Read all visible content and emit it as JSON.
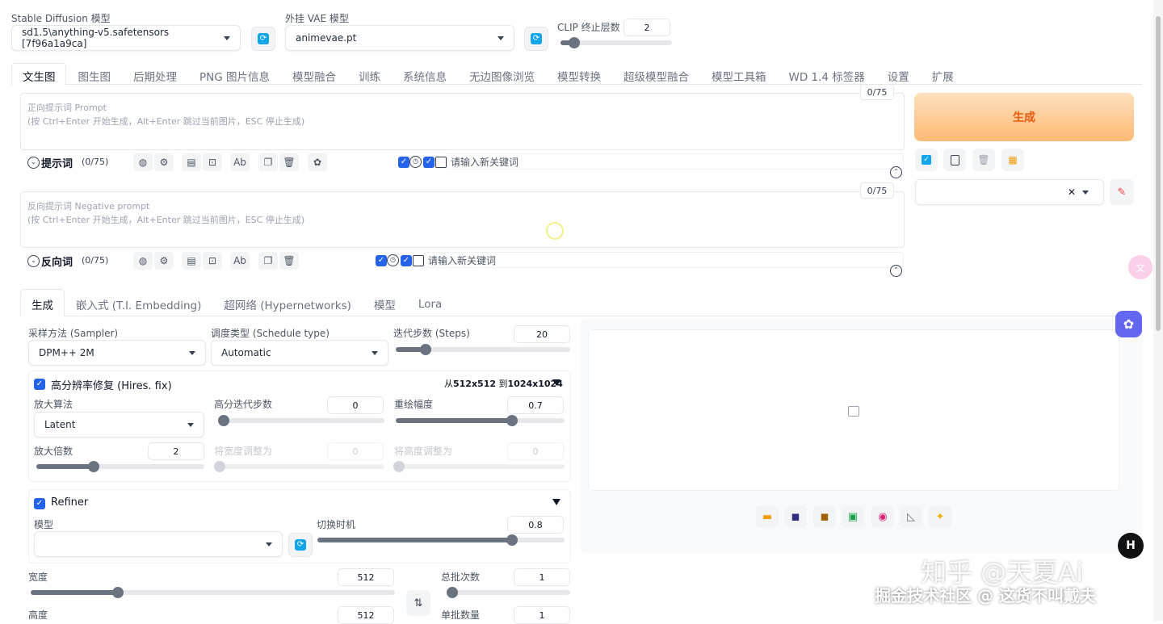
{
  "top": {
    "sd_model": {
      "label": "Stable Diffusion 模型",
      "value": "sd1.5\\anything-v5.safetensors [7f96a1a9ca]"
    },
    "vae": {
      "label": "外挂 VAE 模型",
      "value": "animevae.pt"
    },
    "clip": {
      "label": "CLIP 终止层数",
      "value": "2",
      "fraction": 0.08
    }
  },
  "main_tabs": [
    "文生图",
    "图生图",
    "后期处理",
    "PNG 图片信息",
    "模型融合",
    "训练",
    "系统信息",
    "无边图像浏览",
    "模型转换",
    "超级模型融合",
    "模型工具箱",
    "WD 1.4 标签器",
    "设置",
    "扩展"
  ],
  "prompt": {
    "counter": "0/75",
    "placeholder_line1": "正向提示词 Prompt",
    "placeholder_line2": "(按 Ctrl+Enter 开始生成，Alt+Enter 跳过当前图片，ESC 停止生成)",
    "toggle_label": "提示词",
    "token_count": "(0/75)",
    "keyword_placeholder": "请输入新关键词"
  },
  "negative": {
    "counter": "0/75",
    "placeholder_line1": "反向提示词 Negative prompt",
    "placeholder_line2": "(按 Ctrl+Enter 开始生成，Alt+Enter 跳过当前图片，ESC 停止生成)",
    "toggle_label": "反向词",
    "token_count": "(0/75)",
    "keyword_placeholder": "请输入新关键词"
  },
  "generate_label": "生成",
  "sub_tabs": [
    "生成",
    "嵌入式 (T.I. Embedding)",
    "超网络 (Hypernetworks)",
    "模型",
    "Lora"
  ],
  "sampler": {
    "label": "采样方法 (Sampler)",
    "value": "DPM++ 2M"
  },
  "schedule": {
    "label": "调度类型 (Schedule type)",
    "value": "Automatic"
  },
  "steps": {
    "label": "迭代步数 (Steps)",
    "value": "20",
    "fraction": 0.15
  },
  "hires": {
    "title": "高分辨率修复 (Hires. fix)",
    "summary_prefix": "从",
    "summary_from": "512x512",
    "summary_mid": "到",
    "summary_to": "1024x1024",
    "upscaler": {
      "label": "放大算法",
      "value": "Latent"
    },
    "hires_steps": {
      "label": "高分迭代步数",
      "value": "0",
      "fraction": 0.0
    },
    "denoise": {
      "label": "重绘幅度",
      "value": "0.7",
      "fraction": 0.7
    },
    "scale": {
      "label": "放大倍数",
      "value": "2",
      "fraction": 0.33
    },
    "resize_w": {
      "label": "将宽度调整为",
      "value": "0"
    },
    "resize_h": {
      "label": "将高度调整为",
      "value": "0"
    }
  },
  "refiner": {
    "title": "Refiner",
    "model_label": "模型",
    "switch": {
      "label": "切换时机",
      "value": "0.8",
      "fraction": 0.8
    }
  },
  "width": {
    "label": "宽度",
    "value": "512",
    "fraction": 0.23
  },
  "height": {
    "label": "高度",
    "value": "512"
  },
  "batch_count": {
    "label": "总批次数",
    "value": "1",
    "fraction": 0.0
  },
  "batch_size": {
    "label": "单批数量",
    "value": "1"
  },
  "watermark": {
    "line1": "知乎 @天夏Ai",
    "line2": "掘金技术社区 @ 这货不叫戴夫"
  }
}
